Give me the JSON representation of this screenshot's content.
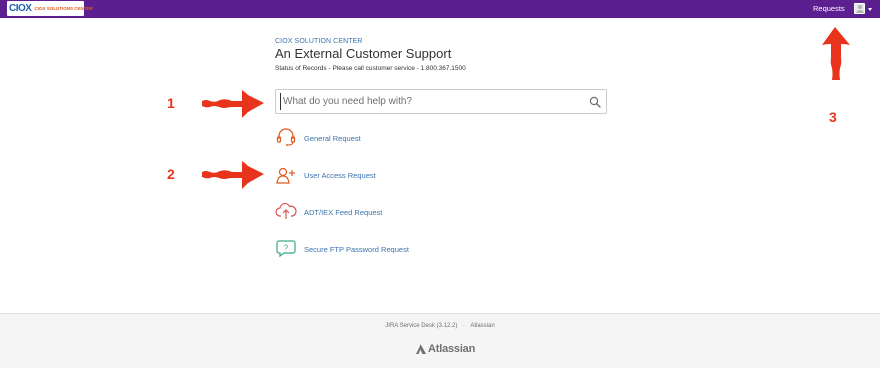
{
  "topbar": {
    "logo_mark": "CIOX",
    "logo_text": "CIOX SOLUTIONS CENTER",
    "requests_label": "Requests"
  },
  "header": {
    "help_center": "CIOX SOLUTION CENTER",
    "title": "An External Customer Support",
    "subtitle": "Status of Records - Please call customer service - 1.800.367.1500"
  },
  "search": {
    "placeholder": "What do you need help with?"
  },
  "requests": [
    {
      "label": "General Request",
      "icon": "headset-icon"
    },
    {
      "label": "User Access Request",
      "icon": "user-plus-icon"
    },
    {
      "label": "ADT/IEX Feed Request",
      "icon": "cloud-upload-icon"
    },
    {
      "label": "Secure FTP Password Request",
      "icon": "question-bubble-icon"
    }
  ],
  "annotations": {
    "one": "1",
    "two": "2",
    "three": "3"
  },
  "footer": {
    "product": "JIRA Service Desk (3.12.2)",
    "separator": "·",
    "vendor": "Atlassian",
    "logo_text": "Atlassian"
  },
  "colors": {
    "topbar": "#5b1f90",
    "link": "#3b73af",
    "annotation": "#e8341c",
    "orange_icon": "#e05a1e",
    "red_icon": "#d9534f",
    "teal_icon": "#3aa88a"
  }
}
